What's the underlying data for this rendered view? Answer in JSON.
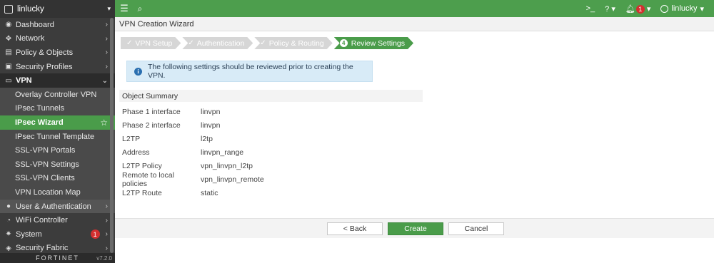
{
  "device": {
    "name": "linlucky"
  },
  "sidebar": {
    "items": [
      {
        "label": "Dashboard",
        "icon": "dashboard-icon"
      },
      {
        "label": "Network",
        "icon": "network-icon"
      },
      {
        "label": "Policy & Objects",
        "icon": "policy-icon"
      },
      {
        "label": "Security Profiles",
        "icon": "lock-icon"
      }
    ],
    "vpn_section": "VPN",
    "vpn_items": [
      {
        "label": "Overlay Controller VPN"
      },
      {
        "label": "IPsec Tunnels"
      },
      {
        "label": "IPsec Wizard"
      },
      {
        "label": "IPsec Tunnel Template"
      },
      {
        "label": "SSL-VPN Portals"
      },
      {
        "label": "SSL-VPN Settings"
      },
      {
        "label": "SSL-VPN Clients"
      },
      {
        "label": "VPN Location Map"
      }
    ],
    "bottom_items": [
      {
        "label": "User & Authentication"
      },
      {
        "label": "WiFi Controller"
      },
      {
        "label": "System",
        "badge": "1"
      },
      {
        "label": "Security Fabric"
      }
    ],
    "footer_logo": "FORTINET",
    "footer_version": "v7.2.0"
  },
  "topbar": {
    "bell_count": "1",
    "user": "linlucky"
  },
  "wizard": {
    "title": "VPN Creation Wizard",
    "steps": [
      {
        "label": "VPN Setup",
        "state": "done"
      },
      {
        "label": "Authentication",
        "state": "done"
      },
      {
        "label": "Policy & Routing",
        "state": "done"
      },
      {
        "label": "Review Settings",
        "state": "current",
        "num": "4"
      }
    ],
    "info": "The following settings should be reviewed prior to creating the VPN.",
    "summary_title": "Object Summary",
    "summary": [
      {
        "label": "Phase 1 interface",
        "value": "linvpn"
      },
      {
        "label": "Phase 2 interface",
        "value": "linvpn"
      },
      {
        "label": "L2TP",
        "value": "l2tp"
      },
      {
        "label": "Address",
        "value": "linvpn_range"
      },
      {
        "label": "L2TP Policy",
        "value": "vpn_linvpn_l2tp"
      },
      {
        "label": "Remote to local policies",
        "value": "vpn_linvpn_remote"
      },
      {
        "label": "L2TP Route",
        "value": "static"
      }
    ],
    "buttons": {
      "back": "< Back",
      "create": "Create",
      "cancel": "Cancel"
    }
  },
  "colors": {
    "brand_green": "#4d9e4d",
    "sidebar_bg": "#3c3c3c",
    "info_bg": "#d8ebf7",
    "badge_red": "#d32f2f"
  }
}
